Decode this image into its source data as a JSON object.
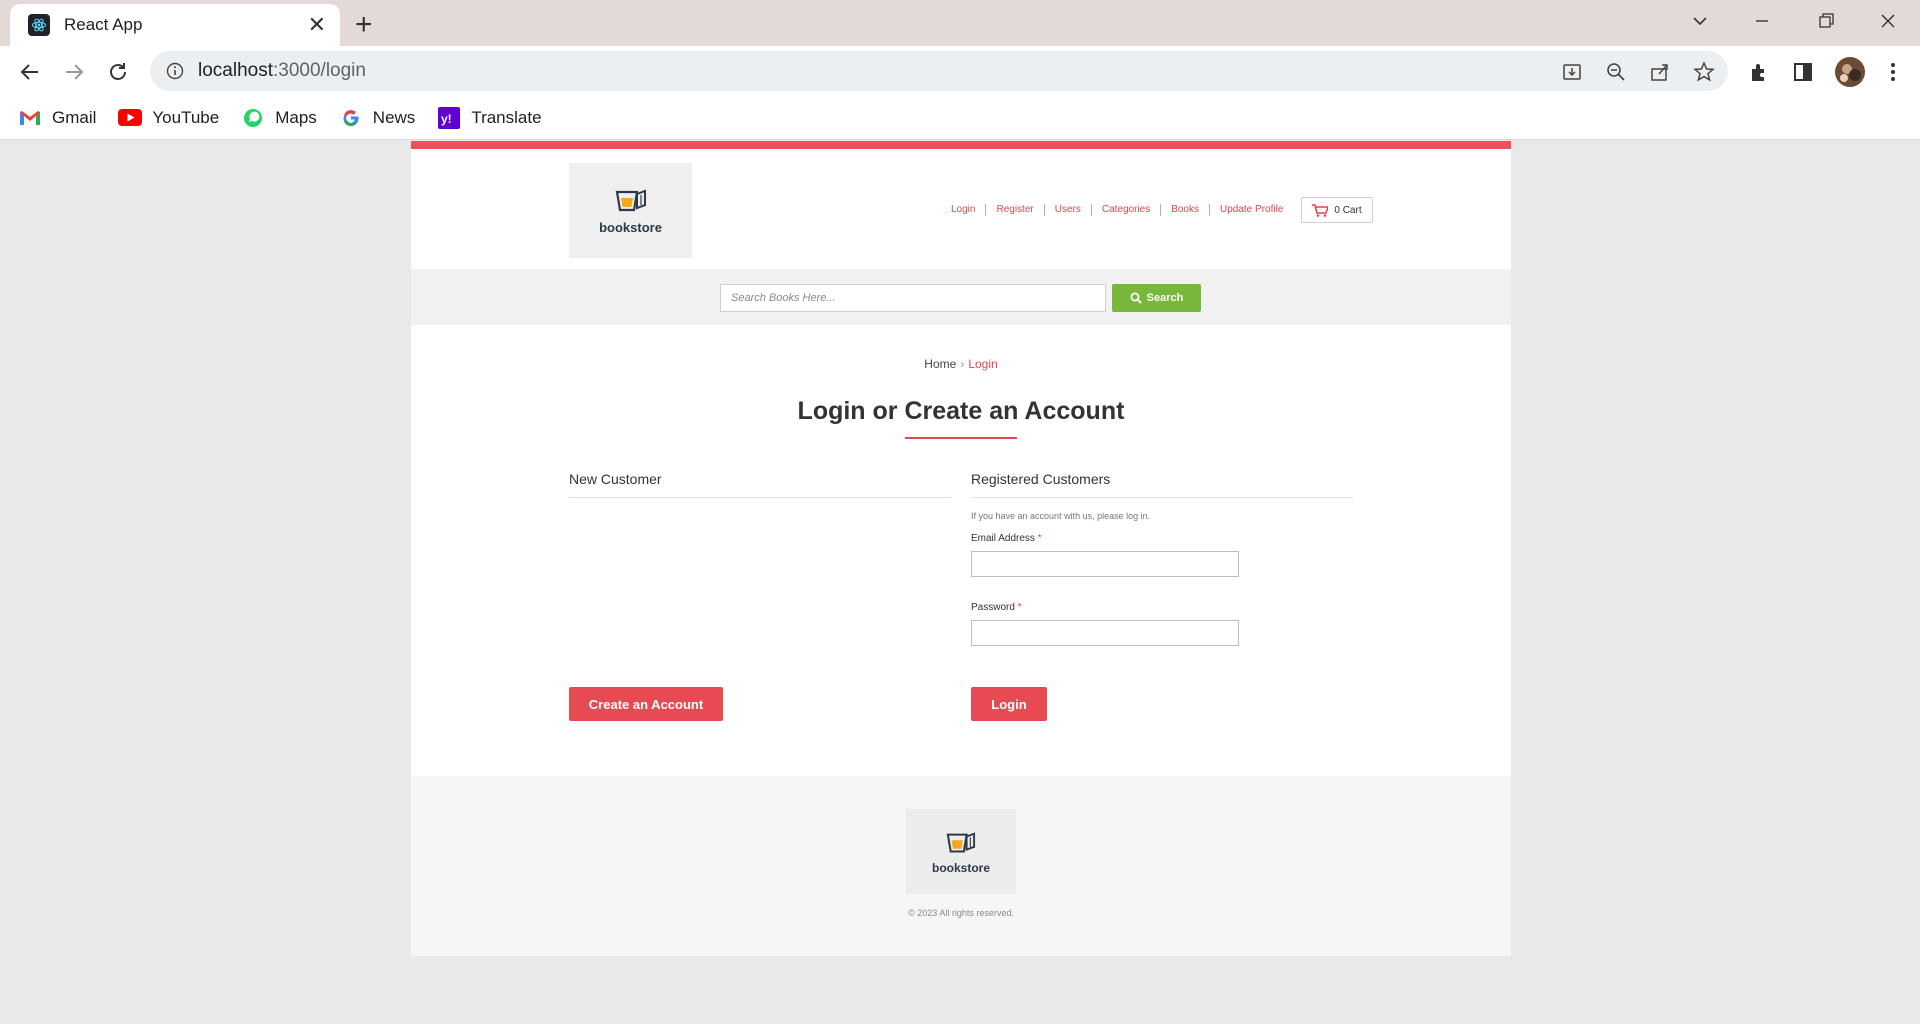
{
  "browser": {
    "tab_title": "React App",
    "tab_close": "✕",
    "new_tab": "+",
    "url_host": "localhost",
    "url_path": ":3000/login",
    "bookmarks": [
      {
        "label": "Gmail",
        "icon": "gmail-icon"
      },
      {
        "label": "YouTube",
        "icon": "youtube-icon"
      },
      {
        "label": "Maps",
        "icon": "maps-icon"
      },
      {
        "label": "News",
        "icon": "google-news-icon"
      },
      {
        "label": "Translate",
        "icon": "yahoo-translate-icon"
      }
    ]
  },
  "header": {
    "logo_text": "bookstore",
    "nav": [
      "Login",
      "Register",
      "Users",
      "Categories",
      "Books",
      "Update Profile"
    ],
    "cart_label": "0 Cart"
  },
  "search": {
    "placeholder": "Search Books Here...",
    "button_label": "Search"
  },
  "breadcrumb": {
    "home": "Home",
    "separator": "›",
    "current": "Login"
  },
  "main": {
    "title": "Login or Create an Account",
    "new_customer": {
      "heading": "New Customer",
      "button_label": "Create an Account"
    },
    "registered": {
      "heading": "Registered Customers",
      "hint": "If you have an account with us, please log in.",
      "email_label": "Email Address",
      "password_label": "Password",
      "required_mark": "*",
      "email_value": "",
      "password_value": "",
      "button_label": "Login"
    }
  },
  "footer": {
    "logo_text": "bookstore",
    "copyright": "© 2023 All rights reserved."
  },
  "colors": {
    "accent_red": "#e84a53",
    "search_green": "#77b73a",
    "page_bg": "#e9e9e9"
  }
}
